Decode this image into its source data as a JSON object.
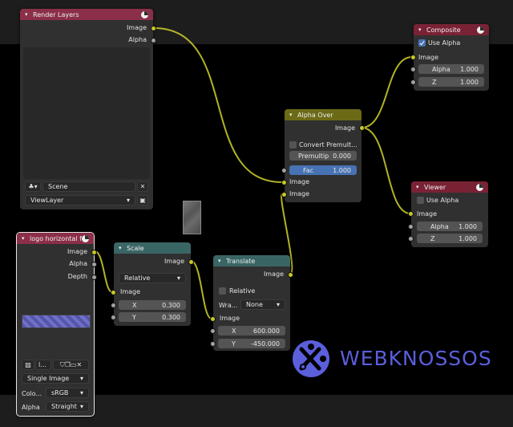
{
  "colors": {
    "input_header": "#8b2f49",
    "color_header": "#6c6a16",
    "output_header": "#7a2235",
    "distort_header": "#3a6565",
    "socket_image": "#c7c729",
    "socket_value": "#a1a1a1",
    "accent": "#4772b3",
    "logo_purple": "#5b5fdc"
  },
  "render_layers": {
    "title": "Render Layers",
    "out_image": "Image",
    "out_alpha": "Alpha",
    "scene": "Scene",
    "view_layer": "ViewLayer"
  },
  "logo_node": {
    "title": "logo horizontal f...",
    "out_image": "Image",
    "out_alpha": "Alpha",
    "out_depth": "Depth",
    "image_name": "l...",
    "source": "Single Image",
    "colorspace_label": "Colo...",
    "colorspace": "sRGB",
    "alpha_label": "Alpha",
    "alpha_mode": "Straight"
  },
  "scale": {
    "title": "Scale",
    "out_image": "Image",
    "space": "Relative",
    "in_image": "Image",
    "x_label": "X",
    "x_value": "0.300",
    "y_label": "Y",
    "y_value": "0.300"
  },
  "translate": {
    "title": "Translate",
    "out_image": "Image",
    "relative_label": "Relative",
    "wrap_label": "Wra...",
    "wrap_value": "None",
    "in_image": "Image",
    "x_label": "X",
    "x_value": "600.000",
    "y_label": "Y",
    "y_value": "-450.000"
  },
  "alpha_over": {
    "title": "Alpha Over",
    "out_image": "Image",
    "convert_label": "Convert Premult...",
    "premultip_label": "Premultip",
    "premultip_value": "0.000",
    "fac_label": "Fac",
    "fac_value": "1.000",
    "in_image1": "Image",
    "in_image2": "Image"
  },
  "composite": {
    "title": "Composite",
    "use_alpha": "Use Alpha",
    "in_image": "Image",
    "alpha_label": "Alpha",
    "alpha_value": "1.000",
    "z_label": "Z",
    "z_value": "1.000"
  },
  "viewer": {
    "title": "Viewer",
    "use_alpha": "Use Alpha",
    "in_image": "Image",
    "alpha_label": "Alpha",
    "alpha_value": "1.000",
    "z_label": "Z",
    "z_value": "1.000"
  },
  "backdrop_logo": {
    "text": "WEBKNOSSOS"
  }
}
